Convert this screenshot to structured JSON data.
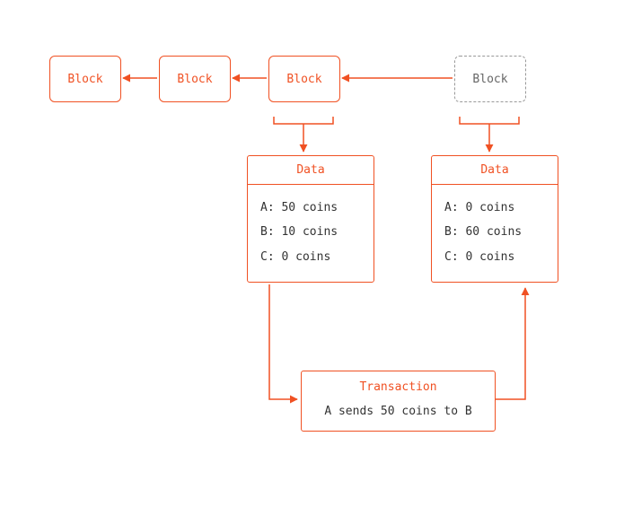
{
  "blocks": [
    {
      "label": "Block"
    },
    {
      "label": "Block"
    },
    {
      "label": "Block"
    },
    {
      "label": "Block"
    }
  ],
  "data_panels": [
    {
      "header": "Data",
      "lines": [
        "A: 50 coins",
        "B: 10 coins",
        "C: 0 coins"
      ]
    },
    {
      "header": "Data",
      "lines": [
        "A: 0 coins",
        "B: 60 coins",
        "C: 0 coins"
      ]
    }
  ],
  "transaction": {
    "header": "Transaction",
    "body": "A sends 50 coins to B"
  },
  "colors": {
    "accent": "#f05123",
    "muted": "#999"
  }
}
